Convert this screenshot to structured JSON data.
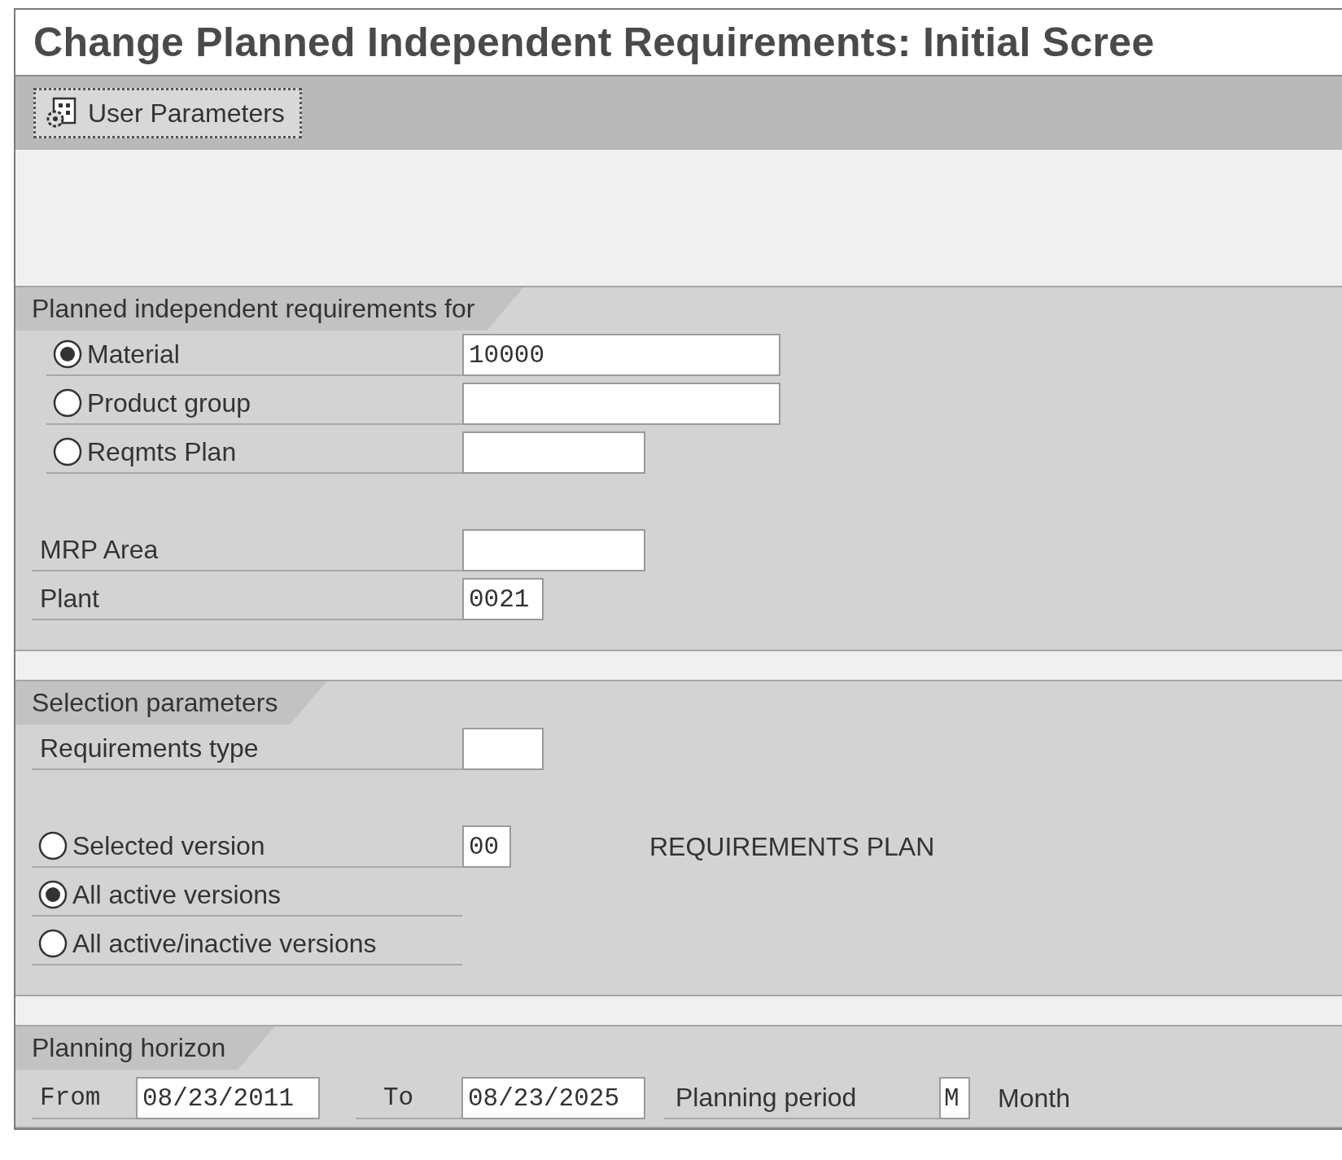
{
  "window": {
    "title": "Change Planned Independent Requirements: Initial Scree"
  },
  "toolbar": {
    "buttons": [
      {
        "label": "User Parameters"
      }
    ]
  },
  "sections": [
    {
      "title": "Planned independent requirements for",
      "rows": [
        {
          "kind": "radio",
          "label": "Material",
          "selected": true,
          "value": "10000"
        },
        {
          "kind": "radio",
          "label": "Product group",
          "selected": false
        },
        {
          "kind": "radio",
          "label": "Reqmts Plan",
          "selected": false
        },
        {
          "kind": "gap"
        },
        {
          "kind": "field",
          "label": "MRP Area"
        },
        {
          "kind": "field",
          "label": "Plant",
          "value": "0021"
        }
      ]
    },
    {
      "title": "Selection parameters",
      "rows": [
        {
          "kind": "field",
          "label": "Requirements type"
        },
        {
          "kind": "gap"
        },
        {
          "kind": "radio",
          "label": "Selected version",
          "selected": false,
          "value": "00",
          "description": "REQUIREMENTS PLAN"
        },
        {
          "kind": "radio",
          "label": "All active versions",
          "selected": true
        },
        {
          "kind": "radio",
          "label": "All active/inactive versions",
          "selected": false
        }
      ]
    },
    {
      "title": "Planning horizon",
      "horizon": {
        "from_label": "From",
        "from": "08/23/2011",
        "to_label": "To",
        "to": "08/23/2025",
        "period_label": "Planning period",
        "period": "M",
        "period_text": "Month"
      }
    }
  ]
}
